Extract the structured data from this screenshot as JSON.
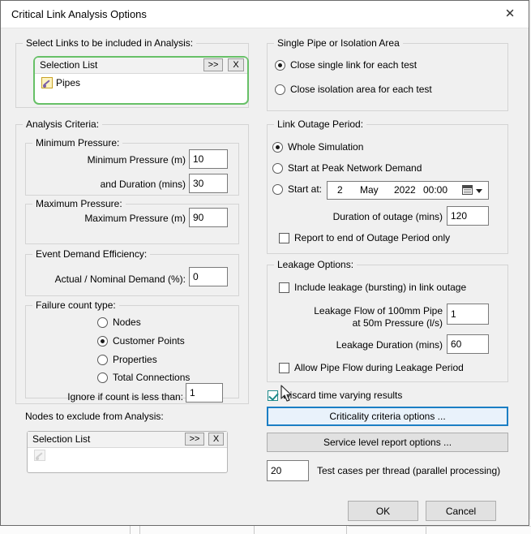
{
  "window": {
    "title": "Critical Link Analysis Options",
    "close_icon": "close-icon"
  },
  "left": {
    "select_links_legend": "Select Links to be included in Analysis:",
    "links_list": {
      "header": "Selection List",
      "browse_label": ">>",
      "clear_label": "X",
      "items": [
        {
          "icon": "pipe-icon",
          "label": "Pipes"
        }
      ]
    },
    "analysis_criteria_legend": "Analysis Criteria:",
    "min_pressure": {
      "legend": "Minimum Pressure:",
      "fields": [
        {
          "label": "Minimum Pressure (m)",
          "value": "10"
        },
        {
          "label": "and Duration (mins)",
          "value": "30"
        }
      ]
    },
    "max_pressure": {
      "legend": "Maximum Pressure:",
      "fields": [
        {
          "label": "Maximum Pressure (m)",
          "value": "90"
        }
      ]
    },
    "event_demand": {
      "legend": "Event Demand Efficiency:",
      "fields": [
        {
          "label": "Actual / Nominal Demand (%):",
          "value": "0"
        }
      ]
    },
    "failure_count": {
      "legend": "Failure count type:",
      "options": [
        {
          "label": "Nodes",
          "selected": false
        },
        {
          "label": "Customer Points",
          "selected": true
        },
        {
          "label": "Properties",
          "selected": false
        },
        {
          "label": "Total Connections",
          "selected": false
        }
      ],
      "ignore_label": "Ignore if count is less than:",
      "ignore_value": "1"
    },
    "exclude_nodes_legend": "Nodes to exclude from Analysis:",
    "exclude_list": {
      "header": "Selection List",
      "browse_label": ">>",
      "clear_label": "X",
      "items": [
        {
          "icon": "node-icon-disabled",
          "label": ""
        }
      ]
    }
  },
  "right": {
    "single_pipe": {
      "legend": "Single Pipe or Isolation Area",
      "options": [
        {
          "label": "Close single link for each test",
          "selected": true
        },
        {
          "label": "Close isolation area for each test",
          "selected": false
        }
      ]
    },
    "outage": {
      "legend": "Link Outage Period:",
      "options": [
        {
          "label": "Whole Simulation",
          "selected": true
        },
        {
          "label": "Start at Peak Network Demand",
          "selected": false
        },
        {
          "label": "Start at:",
          "selected": false
        }
      ],
      "date": {
        "day": "2",
        "month": "May",
        "year": "2022",
        "time": "00:00",
        "icon": "calendar-icon"
      },
      "duration_label": "Duration of outage (mins)",
      "duration_value": "120",
      "report_end_label": "Report to end of Outage Period only",
      "report_end_checked": false
    },
    "leakage": {
      "legend": "Leakage Options:",
      "include_label": "Include leakage (bursting) in link outage",
      "include_checked": false,
      "flow_label_line1": "Leakage Flow of 100mm Pipe",
      "flow_label_line2": "at 50m Pressure (l/s)",
      "flow_value": "1",
      "duration_label": "Leakage Duration (mins)",
      "duration_value": "60",
      "allow_flow_label": "Allow Pipe Flow during Leakage Period",
      "allow_flow_checked": false
    },
    "discard_label": "Discard time varying results",
    "discard_checked": true,
    "criticality_button": "Criticality criteria options ...",
    "service_button": "Service level report options ...",
    "threads_value": "20",
    "threads_label": "Test cases per thread (parallel processing)"
  },
  "footer": {
    "ok_label": "OK",
    "cancel_label": "Cancel"
  },
  "colors": {
    "accent_focus": "#1b7ec4",
    "selection_highlight": "#67c067",
    "check_mark": "#1f8a8a",
    "dialog_bg": "#f0f0f0"
  }
}
